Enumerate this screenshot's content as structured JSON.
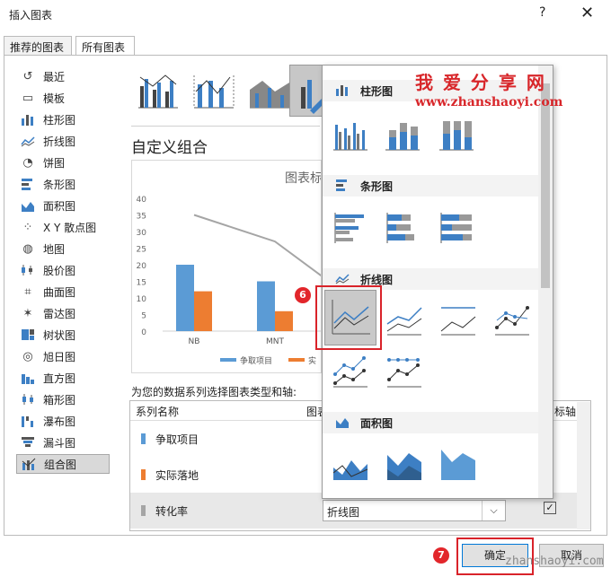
{
  "window": {
    "title": "插入图表",
    "help": "?",
    "close": "✕"
  },
  "tabs": [
    {
      "label": "推荐的图表"
    },
    {
      "label": "所有图表"
    }
  ],
  "sidebar": {
    "items": [
      {
        "label": "最近",
        "icon": "recent-icon"
      },
      {
        "label": "模板",
        "icon": "template-icon"
      },
      {
        "label": "柱形图",
        "icon": "column-chart-icon"
      },
      {
        "label": "折线图",
        "icon": "line-chart-icon"
      },
      {
        "label": "饼图",
        "icon": "pie-chart-icon"
      },
      {
        "label": "条形图",
        "icon": "bar-chart-icon"
      },
      {
        "label": "面积图",
        "icon": "area-chart-icon"
      },
      {
        "label": "X Y 散点图",
        "icon": "scatter-chart-icon"
      },
      {
        "label": "地图",
        "icon": "map-chart-icon"
      },
      {
        "label": "股价图",
        "icon": "stock-chart-icon"
      },
      {
        "label": "曲面图",
        "icon": "surface-chart-icon"
      },
      {
        "label": "雷达图",
        "icon": "radar-chart-icon"
      },
      {
        "label": "树状图",
        "icon": "treemap-chart-icon"
      },
      {
        "label": "旭日图",
        "icon": "sunburst-chart-icon"
      },
      {
        "label": "直方图",
        "icon": "histogram-chart-icon"
      },
      {
        "label": "箱形图",
        "icon": "box-chart-icon"
      },
      {
        "label": "瀑布图",
        "icon": "waterfall-chart-icon"
      },
      {
        "label": "漏斗图",
        "icon": "funnel-chart-icon"
      },
      {
        "label": "组合图",
        "icon": "combo-chart-icon"
      }
    ]
  },
  "main": {
    "heading": "自定义组合",
    "series_prompt": "为您的数据系列选择图表类型和轴:",
    "preview": {
      "title": "图表标",
      "chart_data": {
        "type": "bar",
        "categories": [
          "NB",
          "MNT"
        ],
        "y_ticks": [
          "0",
          "5",
          "10",
          "15",
          "20",
          "25",
          "30",
          "35",
          "40"
        ],
        "ylim": [
          0,
          40
        ],
        "series": [
          {
            "name": "争取项目",
            "values": [
              20,
              15
            ],
            "color": "#5b9bd5"
          },
          {
            "name": "实际落地",
            "values": [
              12,
              6
            ],
            "color": "#ed7d31"
          }
        ],
        "line_series": {
          "name": "转化率",
          "values": [
            35,
            27
          ],
          "color": "#a5a5a5"
        },
        "legend_visible": [
          "争取项目",
          "实"
        ]
      }
    },
    "table": {
      "headers": {
        "name": "系列名称",
        "type": "图表",
        "axis": "标轴"
      },
      "rows": [
        {
          "name": "争取项目",
          "color": "#5b9bd5"
        },
        {
          "name": "实际落地",
          "color": "#ed7d31"
        },
        {
          "name": "转化率",
          "color": "#a5a5a5",
          "chart_type": "折线图",
          "secondary_axis": "✓"
        }
      ]
    }
  },
  "dropdown": {
    "sections": [
      {
        "label": "柱形图"
      },
      {
        "label": "条形图"
      },
      {
        "label": "折线图"
      },
      {
        "label": "面积图"
      }
    ]
  },
  "annotations": {
    "step6": "6",
    "step7": "7"
  },
  "buttons": {
    "ok": "确定",
    "cancel": "取消"
  },
  "watermark": {
    "title": "我 爱 分 享 网",
    "url": "www.zhanshaoyi.com",
    "bottom": "zhanshaoyi.com"
  },
  "colors": {
    "blue": "#5b9bd5",
    "orange": "#ed7d31",
    "gray": "#a5a5a5",
    "accent_red": "#e2262b"
  }
}
